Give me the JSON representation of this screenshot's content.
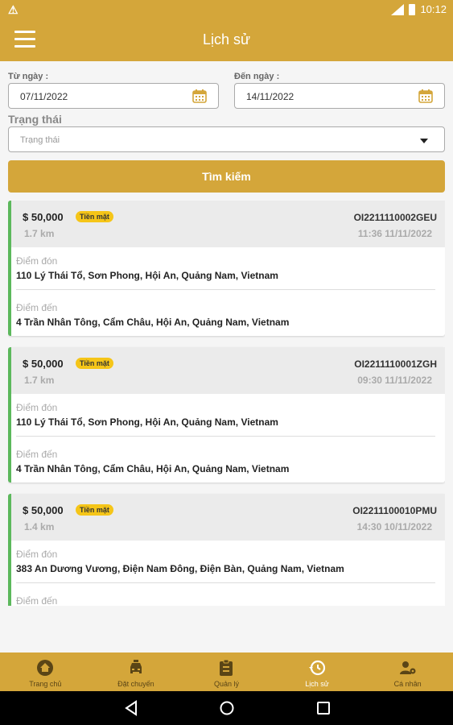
{
  "status_bar": {
    "time": "10:12",
    "warning_icon": "warning-icon"
  },
  "app_bar": {
    "title": "Lịch sử",
    "menu_icon": "menu-icon"
  },
  "filters": {
    "from_label": "Từ ngày :",
    "from_value": "07/11/2022",
    "to_label": "Đến ngày :",
    "to_value": "14/11/2022",
    "status_label": "Trạng thái",
    "status_placeholder": "Trạng thái",
    "search_button": "Tìm kiếm"
  },
  "trips": [
    {
      "price": "$ 50,000",
      "payment": "Tiền mặt",
      "distance": "1.7 km",
      "code": "OI2211110002GEU",
      "time": "11:36 11/11/2022",
      "pickup_label": "Điểm đón",
      "pickup": "110 Lý Thái Tổ, Sơn Phong, Hội An, Quảng Nam, Vietnam",
      "dropoff_label": "Điểm đến",
      "dropoff": "4 Trần Nhân Tông, Cẩm Châu, Hội An, Quảng Nam, Vietnam"
    },
    {
      "price": "$ 50,000",
      "payment": "Tiền mặt",
      "distance": "1.7 km",
      "code": "OI2211110001ZGH",
      "time": "09:30 11/11/2022",
      "pickup_label": "Điểm đón",
      "pickup": "110 Lý Thái Tổ, Sơn Phong, Hội An, Quảng Nam, Vietnam",
      "dropoff_label": "Điểm đến",
      "dropoff": "4 Trần Nhân Tông, Cẩm Châu, Hội An, Quảng Nam, Vietnam"
    },
    {
      "price": "$ 50,000",
      "payment": "Tiền mặt",
      "distance": "1.4 km",
      "code": "OI2211100010PMU",
      "time": "14:30 10/11/2022",
      "pickup_label": "Điểm đón",
      "pickup": "383 An Dương Vương, Điện Nam Đông, Điện Bàn, Quảng Nam, Vietnam",
      "dropoff_label": "Điểm đến",
      "dropoff": ""
    }
  ],
  "bottom_nav": [
    {
      "label": "Trang chủ",
      "icon": "home-icon"
    },
    {
      "label": "Đặt chuyến",
      "icon": "car-icon"
    },
    {
      "label": "Quản lý",
      "icon": "clipboard-icon"
    },
    {
      "label": "Lịch sử",
      "icon": "history-icon",
      "active": true
    },
    {
      "label": "Cá nhân",
      "icon": "user-settings-icon"
    }
  ],
  "colors": {
    "primary": "#d4a63a",
    "accent_border": "#5cb85c",
    "badge": "#f5c518"
  }
}
